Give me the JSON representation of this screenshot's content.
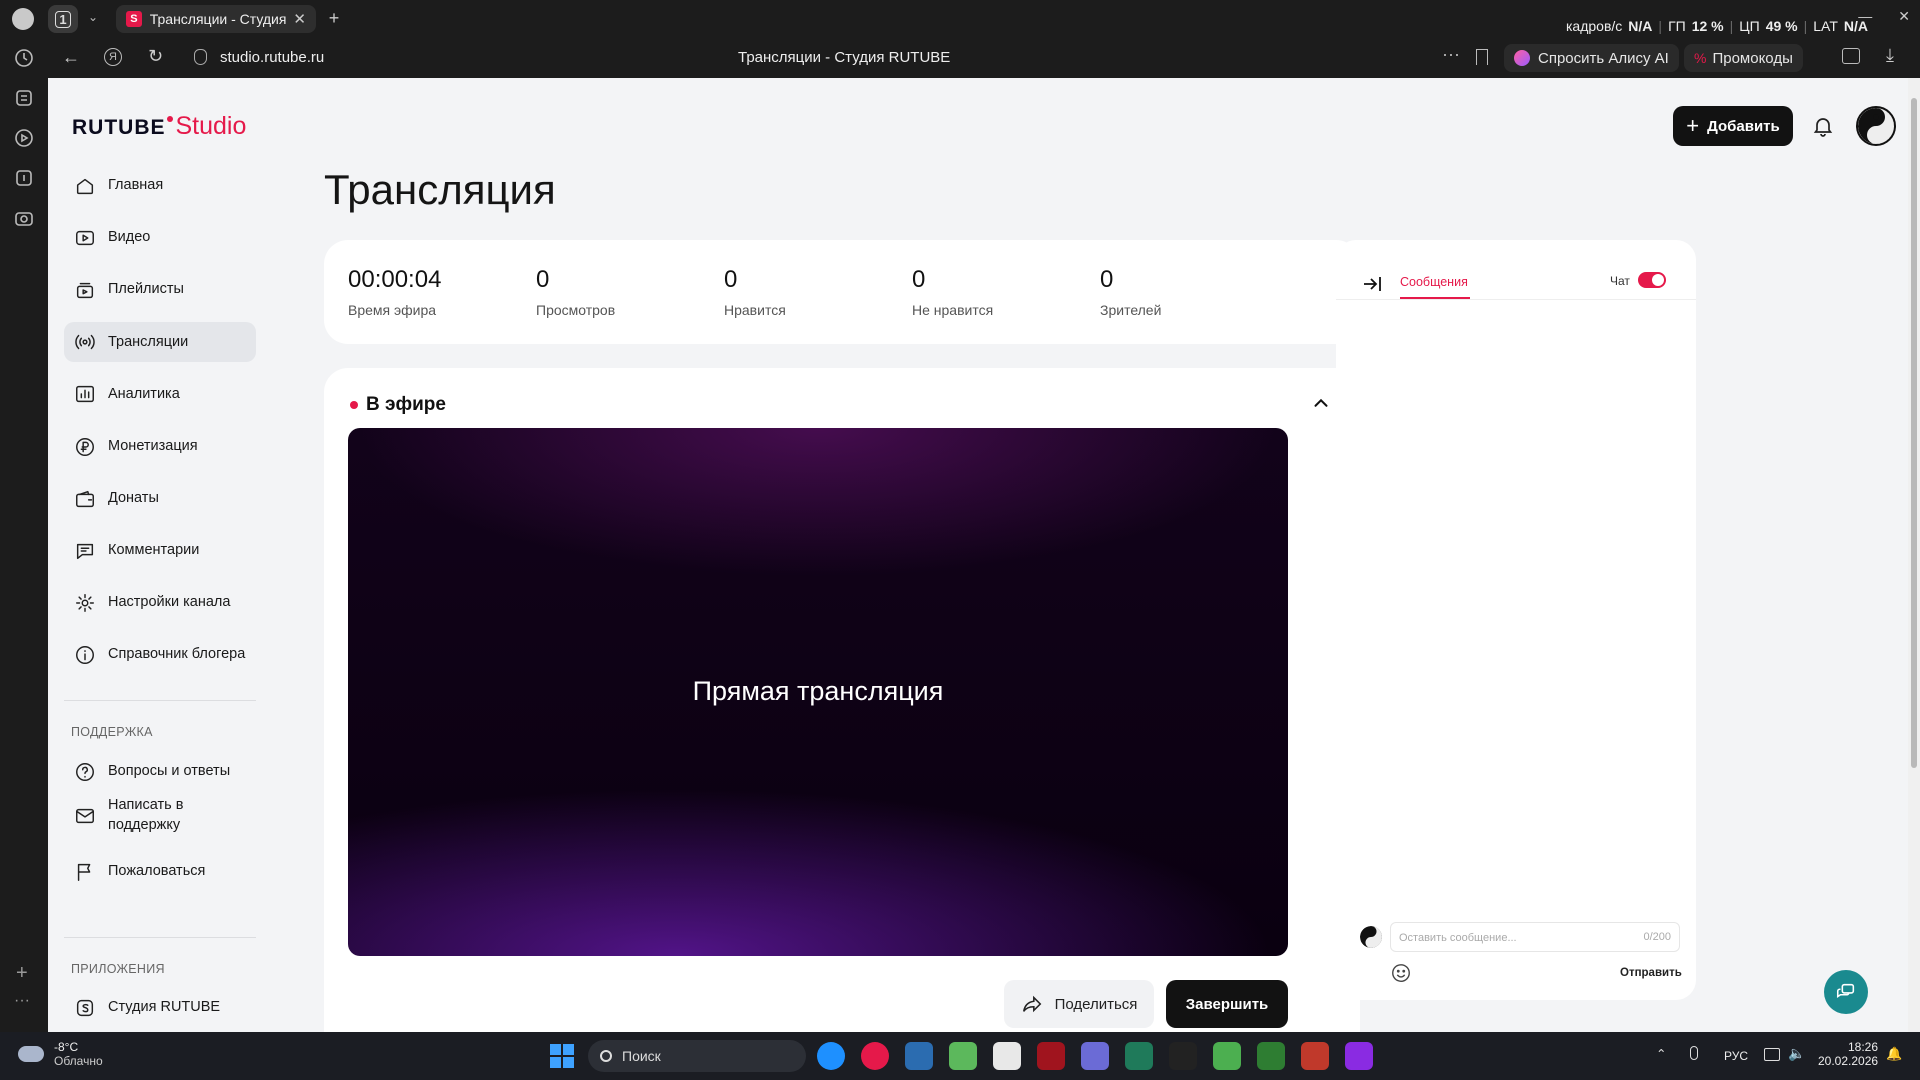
{
  "browser": {
    "tab_count": "1",
    "active_tab_title": "Трансляции - Студия R",
    "address": "studio.rutube.ru",
    "page_title": "Трансляции - Студия RUTUBE",
    "alice_label": "Спросить Алису AI",
    "promo_label": "Промокоды",
    "overlay": {
      "fps_label": "кадров/с",
      "fps_value": "N/A",
      "gpu_label": "ГП",
      "gpu_value": "12 %",
      "cpu_label": "ЦП",
      "cpu_value": "49 %",
      "lat_label": "LAT",
      "lat_value": "N/A"
    }
  },
  "app": {
    "logo_main": "RUTUBE",
    "logo_sub": "Studio",
    "add_button": "Добавить"
  },
  "sidebar": {
    "items": [
      {
        "label": "Главная",
        "icon": "home-icon"
      },
      {
        "label": "Видео",
        "icon": "video-icon"
      },
      {
        "label": "Плейлисты",
        "icon": "playlist-icon"
      },
      {
        "label": "Трансляции",
        "icon": "broadcast-icon",
        "active": true
      },
      {
        "label": "Аналитика",
        "icon": "analytics-icon"
      },
      {
        "label": "Монетизация",
        "icon": "ruble-icon"
      },
      {
        "label": "Донаты",
        "icon": "wallet-icon"
      },
      {
        "label": "Комментарии",
        "icon": "comment-icon"
      },
      {
        "label": "Настройки канала",
        "icon": "gear-icon"
      },
      {
        "label": "Справочник блогера",
        "icon": "info-icon"
      }
    ],
    "support_title": "ПОДДЕРЖКА",
    "support_items": [
      {
        "label": "Вопросы и ответы",
        "icon": "question-icon"
      },
      {
        "label": "Написать в поддержку",
        "icon": "mail-icon"
      },
      {
        "label": "Пожаловаться",
        "icon": "flag-icon"
      }
    ],
    "apps_title": "ПРИЛОЖЕНИЯ",
    "apps_items": [
      {
        "label": "Студия RUTUBE",
        "icon": "studio-app-icon"
      }
    ]
  },
  "main": {
    "title": "Трансляция",
    "stats": [
      {
        "value": "00:00:04",
        "label": "Время эфира"
      },
      {
        "value": "0",
        "label": "Просмотров"
      },
      {
        "value": "0",
        "label": "Нравится"
      },
      {
        "value": "0",
        "label": "Не нравится"
      },
      {
        "value": "0",
        "label": "Зрителей"
      }
    ],
    "live_label": "В эфире",
    "player_text": "Прямая трансляция",
    "share_button": "Поделиться",
    "finish_button": "Завершить"
  },
  "chat": {
    "tab_label": "Сообщения",
    "chat_toggle_label": "Чат",
    "chat_enabled": true,
    "input_placeholder": "Оставить сообщение...",
    "char_counter": "0/200",
    "send_label": "Отправить"
  },
  "taskbar": {
    "weather_temp": "-8°C",
    "weather_desc": "Облачно",
    "search_placeholder": "Поиск",
    "lang": "РУС",
    "time": "18:26",
    "date": "20.02.2026"
  },
  "colors": {
    "accent": "#e5194a",
    "dark_button": "#121212",
    "toggle": "#e5194a"
  }
}
